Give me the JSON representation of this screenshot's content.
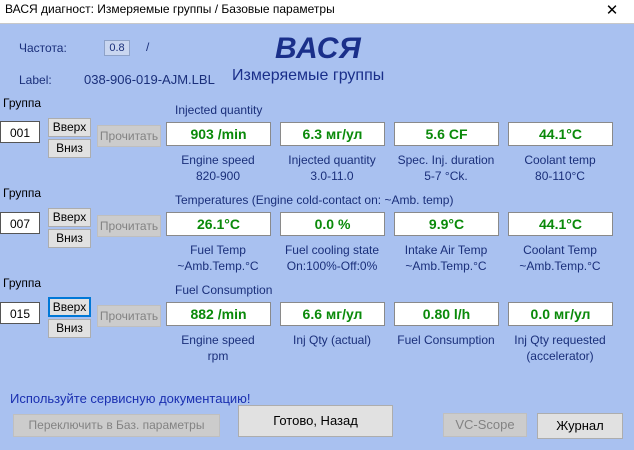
{
  "window": {
    "title": "ВАСЯ диагност: Измеряемые группы / Базовые параметры",
    "close_glyph": "✕"
  },
  "header": {
    "freq_label": "Частота:",
    "freq_value": "0.8",
    "freq_slash": "/",
    "label_label": "Label:",
    "label_value": "038-906-019-AJM.LBL",
    "app_name": "ВАСЯ",
    "screen_title": "Измеряемые группы"
  },
  "groups": [
    {
      "group_label": "Группа",
      "number": "001",
      "up": "Вверх",
      "down": "Вниз",
      "read": "Прочитать",
      "title": "Injected quantity",
      "fields": [
        {
          "value": "903 /min",
          "cap1": "Engine speed",
          "cap2": "820-900"
        },
        {
          "value": "6.3 мг/ул",
          "cap1": "Injected quantity",
          "cap2": "3.0-11.0"
        },
        {
          "value": "5.6 CF",
          "cap1": "Spec. Inj. duration",
          "cap2": "5-7 °Ck."
        },
        {
          "value": "44.1°C",
          "cap1": "Coolant temp",
          "cap2": "80-110°C"
        }
      ]
    },
    {
      "group_label": "Группа",
      "number": "007",
      "up": "Вверх",
      "down": "Вниз",
      "read": "Прочитать",
      "title": "Temperatures (Engine cold-contact on: ~Amb. temp)",
      "fields": [
        {
          "value": "26.1°C",
          "cap1": "Fuel Temp",
          "cap2": "~Amb.Temp.°C"
        },
        {
          "value": "0.0 %",
          "cap1": "Fuel cooling state",
          "cap2": "On:100%-Off:0%"
        },
        {
          "value": "9.9°C",
          "cap1": "Intake Air Temp",
          "cap2": "~Amb.Temp.°C"
        },
        {
          "value": "44.1°C",
          "cap1": "Coolant Temp",
          "cap2": "~Amb.Temp.°C"
        }
      ]
    },
    {
      "group_label": "Группа",
      "number": "015",
      "up": "Вверх",
      "down": "Вниз",
      "read": "Прочитать",
      "title": "Fuel Consumption",
      "fields": [
        {
          "value": "882 /min",
          "cap1": "Engine speed",
          "cap2": "rpm"
        },
        {
          "value": "6.6 мг/ул",
          "cap1": "Inj Qty (actual)",
          "cap2": ""
        },
        {
          "value": "0.80 l/h",
          "cap1": "Fuel Consumption",
          "cap2": ""
        },
        {
          "value": "0.0 мг/ул",
          "cap1": "Inj Qty requested",
          "cap2": "(accelerator)"
        }
      ]
    }
  ],
  "footer": {
    "notice": "Используйте сервисную документацию!",
    "switch_basic": "Переключить в Баз. параметры",
    "done_back": "Готово, Назад",
    "vc_scope": "VC-Scope",
    "journal": "Журнал"
  }
}
